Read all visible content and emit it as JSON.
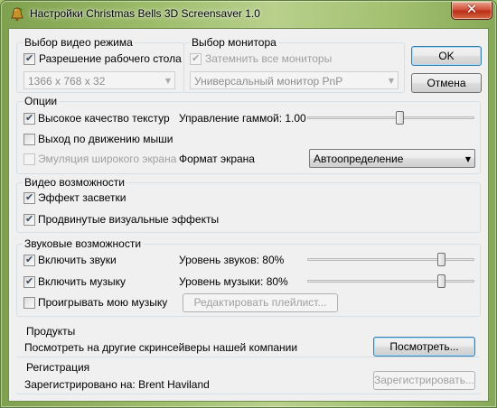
{
  "window": {
    "title": "Настройки Christmas Bells 3D Screensaver 1.0",
    "icons": {
      "app": "bell-app-icon",
      "close": "close-icon"
    },
    "close_glyph": "✕"
  },
  "video_mode": {
    "title": "Выбор видео режима",
    "desktop_res_label": "Разрешение рабочего стола",
    "desktop_res_checked": true,
    "resolution_value": "1366 x 768 x 32"
  },
  "monitor": {
    "title": "Выбор монитора",
    "dim_all_label": "Затемнить все мониторы",
    "dim_all_checked": true,
    "monitor_value": "Универсальный монитор PnP"
  },
  "buttons": {
    "ok": "OK",
    "cancel": "Отмена"
  },
  "options": {
    "title": "Опции",
    "hq_textures_label": "Высокое качество текстур",
    "hq_textures_checked": true,
    "exit_mouse_label": "Выход по движению мыши",
    "exit_mouse_checked": false,
    "widescreen_label": "Эмуляция широкого экрана",
    "widescreen_checked": false,
    "gamma_label": "Управление гаммой: 1.00",
    "gamma_level": 0.55,
    "screen_format_label": "Формат экрана",
    "screen_format_value": "Автоопределение"
  },
  "video_features": {
    "title": "Видео возможности",
    "glow_label": "Эффект засветки",
    "glow_checked": true,
    "advanced_label": "Продвинутые визуальные эффекты",
    "advanced_checked": true
  },
  "sound": {
    "title": "Звуковые возможности",
    "sounds_label": "Включить звуки",
    "sounds_checked": true,
    "music_label": "Включить музыку",
    "music_checked": true,
    "my_music_label": "Проигрывать мою музыку",
    "my_music_checked": false,
    "edit_playlist": "Редактировать плейлист...",
    "sound_level_label": "Уровень звуков: 80%",
    "sound_level": 0.8,
    "music_level_label": "Уровень музыки: 80%",
    "music_level": 0.8
  },
  "products": {
    "title": "Продукты",
    "text": "Посмотреть на другие скринсейверы нашей компании",
    "view_button": "Посмотреть..."
  },
  "registration": {
    "title": "Регистрация",
    "text": "Зарегистрировано на: Brent Haviland",
    "register_button": "Зарегистрировать..."
  }
}
